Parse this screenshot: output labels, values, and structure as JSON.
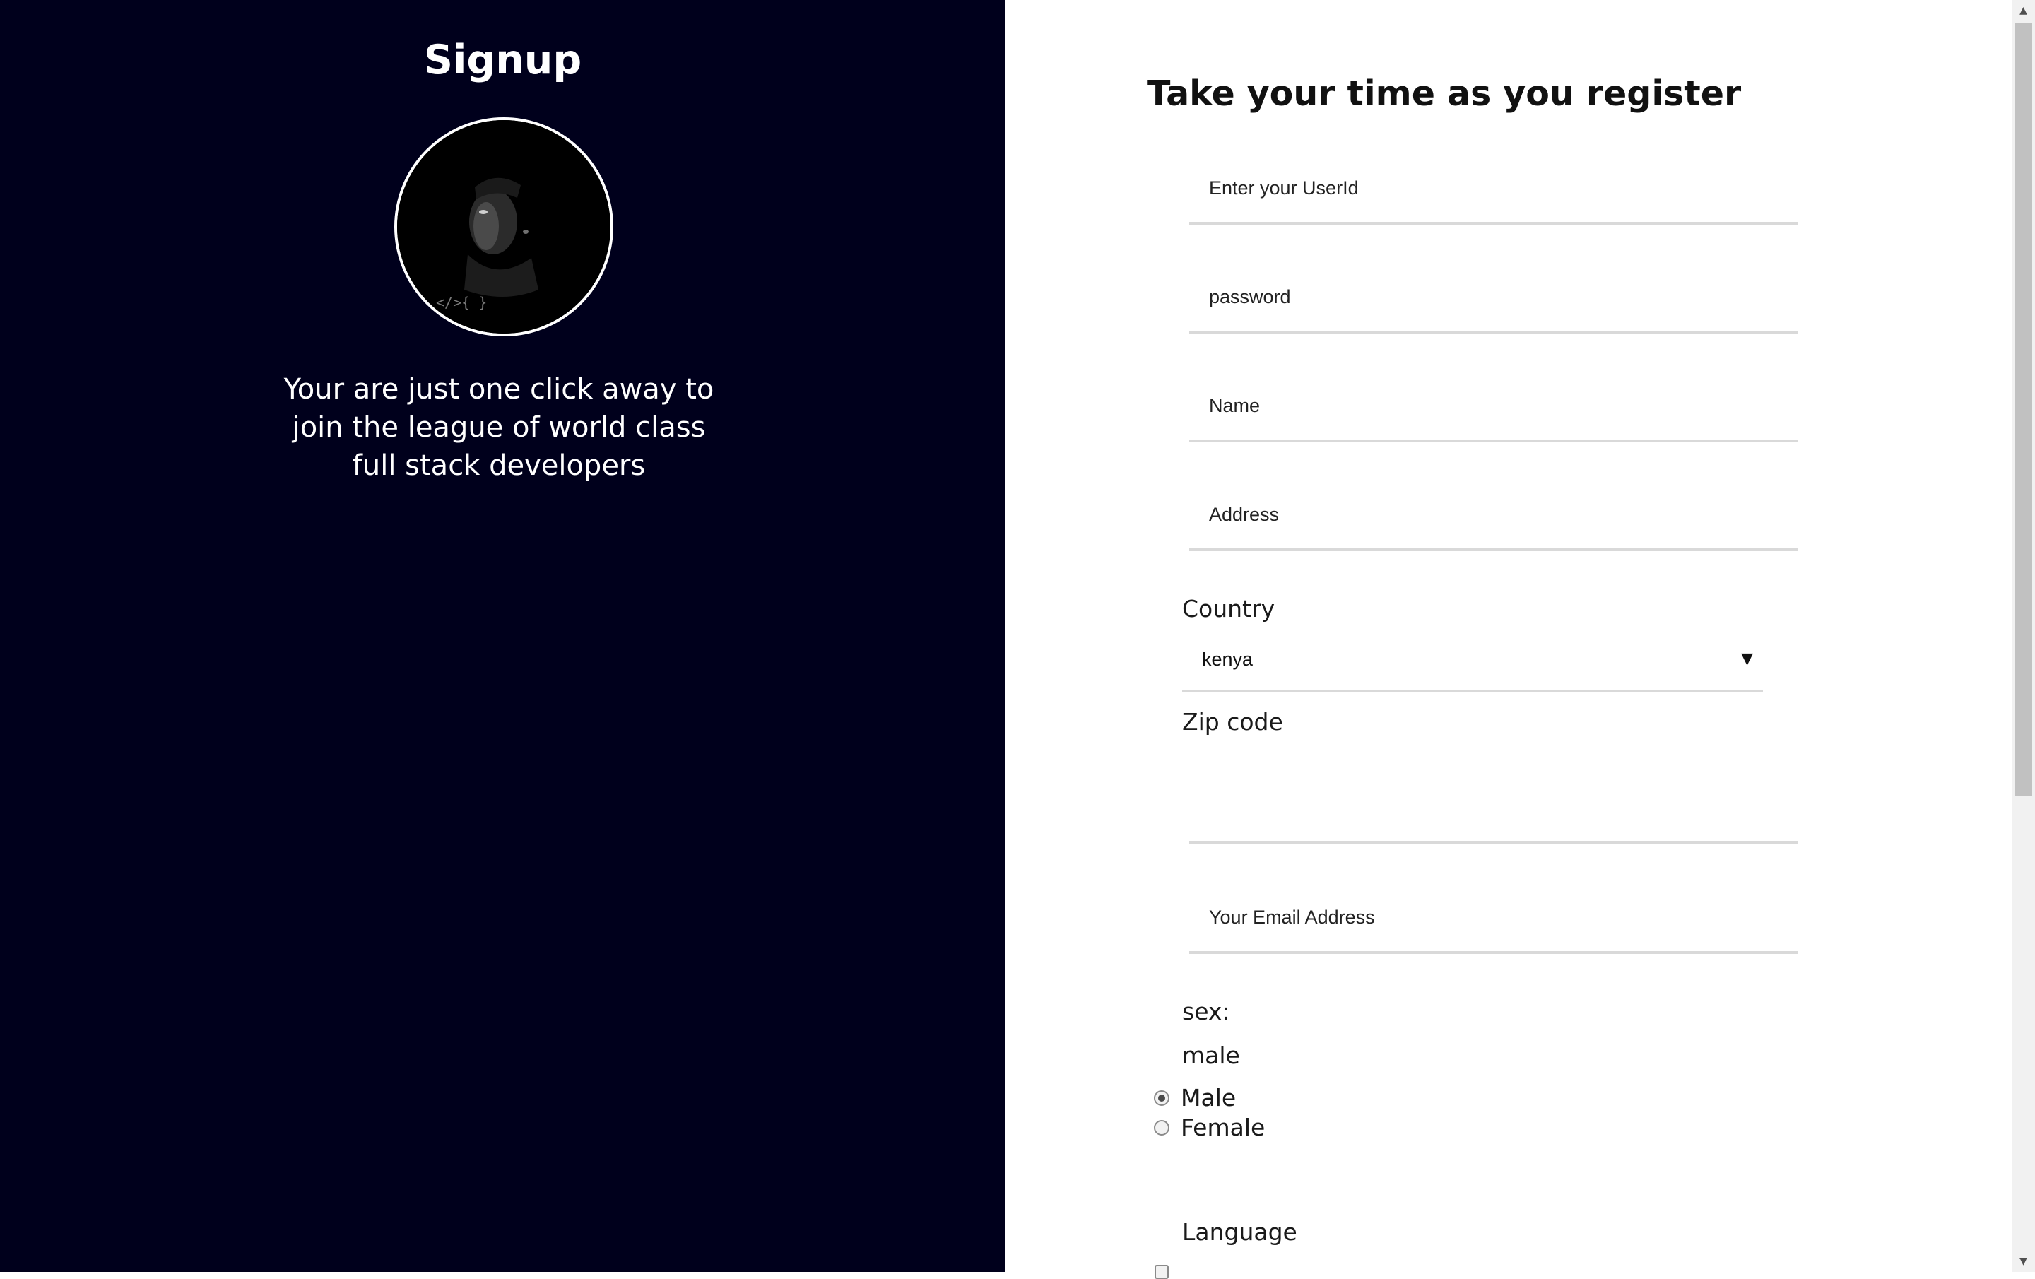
{
  "left": {
    "title": "Signup",
    "avatar_alt": "profile photo",
    "avatar_caption": "</>{ }",
    "tagline": "Your are just one click away to join the league of world class full stack developers"
  },
  "form": {
    "title": "Take your time as you register",
    "userid_placeholder": "Enter your UserId",
    "password_placeholder": "password",
    "name_placeholder": "Name",
    "address_placeholder": "Address",
    "country_label": "Country",
    "country_value": "kenya",
    "select_arrow": "▼",
    "zip_label": "Zip code",
    "zip_placeholder": "",
    "email_placeholder": "Your Email Address",
    "sex_label": "sex:",
    "sex_current": "male",
    "sex_options": [
      {
        "label": "Male",
        "checked": true
      },
      {
        "label": "Female",
        "checked": false
      }
    ],
    "language_label": "Language"
  },
  "scrollbar": {
    "up_arrow": "▲",
    "down_arrow": "▼"
  }
}
